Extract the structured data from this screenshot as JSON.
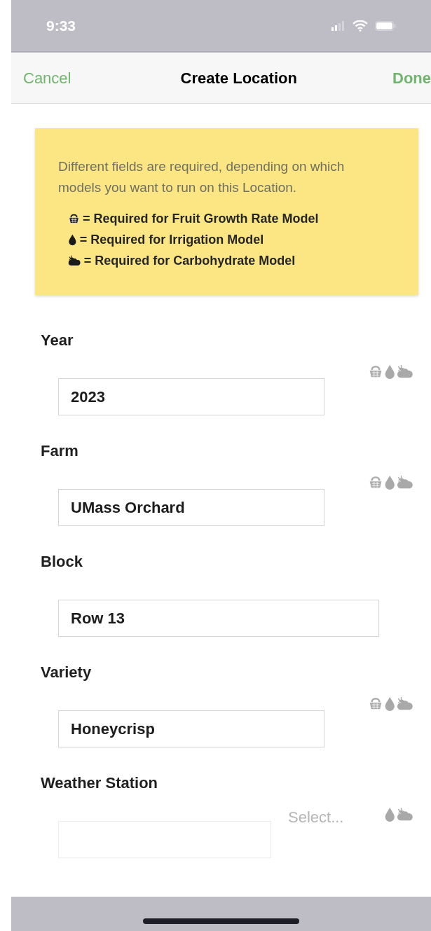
{
  "status_bar": {
    "time": "9:33"
  },
  "nav": {
    "cancel": "Cancel",
    "title": "Create Location",
    "done": "Done"
  },
  "notice": {
    "text": "Different fields are required, depending on which models you want to run on this Location.",
    "legend": [
      {
        "kind": "fruit_growth",
        "text": "= Required for Fruit Growth Rate Model"
      },
      {
        "kind": "irrigation",
        "text": "= Required for Irrigation Model"
      },
      {
        "kind": "carbohydrate",
        "text": "= Required for Carbohydrate Model"
      }
    ]
  },
  "fields": [
    {
      "label": "Year",
      "kind": "text",
      "value": "2023",
      "fruit_growth": true,
      "irrigation": true,
      "carbohydrate": true
    },
    {
      "label": "Farm",
      "kind": "text",
      "value": "UMass Orchard",
      "fruit_growth": true,
      "irrigation": true,
      "carbohydrate": true
    },
    {
      "label": "Block",
      "kind": "text",
      "value": "Row 13",
      "fruit_growth": false,
      "irrigation": false,
      "carbohydrate": false
    },
    {
      "label": "Variety",
      "kind": "text",
      "value": "Honeycrisp",
      "fruit_growth": true,
      "irrigation": true,
      "carbohydrate": true
    },
    {
      "label": "Weather Station",
      "kind": "select",
      "placeholder": "Select...",
      "fruit_growth": false,
      "irrigation": true,
      "carbohydrate": true
    }
  ]
}
